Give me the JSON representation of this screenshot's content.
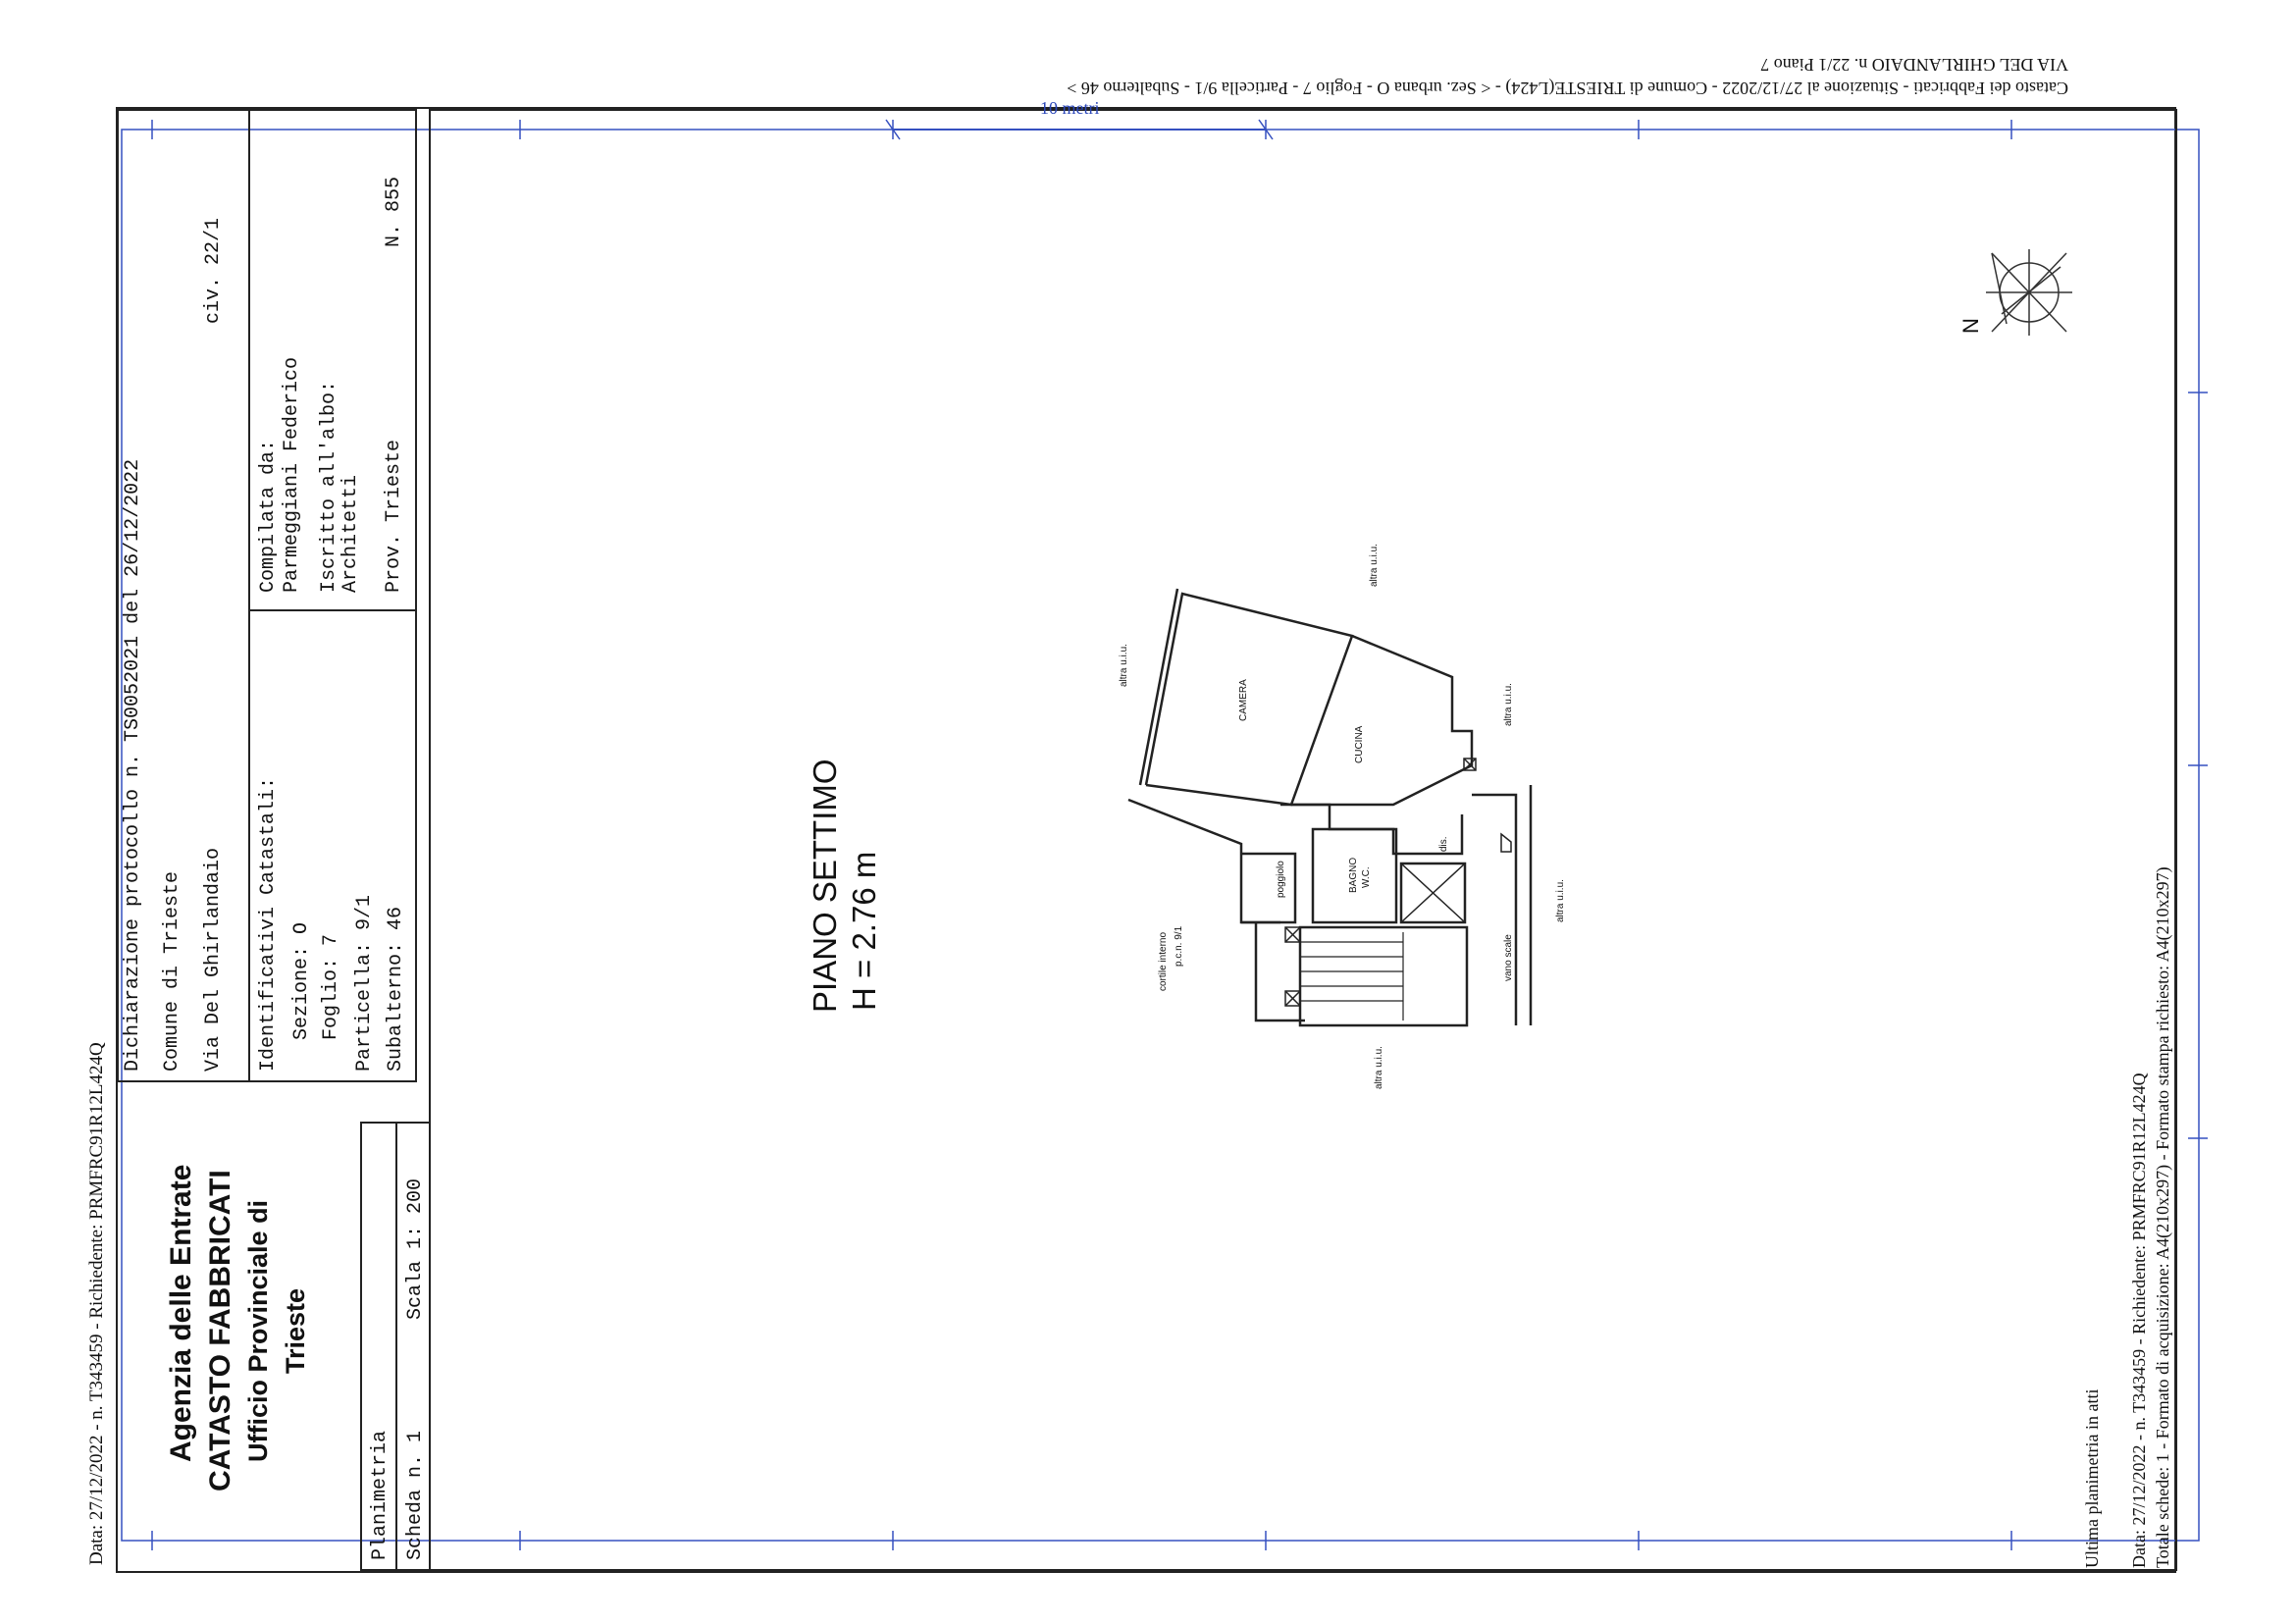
{
  "left_margin": {
    "text": "Data: 27/12/2022 - n. T343459 - Richiedente: PRMFRC91R12L424Q"
  },
  "top_header": {
    "line1": "VIA DEL GHIRLANDAIO n. 22/1 Piano 7",
    "line2": "Catasto dei Fabbricati - Situazione al 27/12/2022 - Comune di TRIESTE(L424) - < Sez. urbana O - Foglio 7 - Particella 9/1 - Subalterno 46 >"
  },
  "scale_bar": {
    "label": "10 metri"
  },
  "title_block": {
    "agency_line1": "Agenzia delle Entrate",
    "agency_line2": "CATASTO FABBRICATI",
    "office_line1": "Ufficio Provinciale di",
    "office_line2": "Trieste",
    "doc_type": "Planimetria",
    "sheet": "Scheda n. 1",
    "scale": "Scala 1: 200",
    "protocol": "Dichiarazione protocollo n. TS0052021 del 26/12/2022",
    "comune": "Comune di Trieste",
    "via": "Via Del Ghirlandaio",
    "civ": "civ. 22/1",
    "id_label": "Identificativi Catastali:",
    "sezione": "Sezione: O",
    "foglio": "Foglio: 7",
    "particella": "Particella: 9/1",
    "subalterno": "Subalterno: 46",
    "compilata_label": "Compilata da:",
    "compilata_name": "Parmeggiani Federico",
    "iscritto_label": "Iscritto all'albo:",
    "iscritto_value": "Architetti",
    "prov": "Prov. Trieste",
    "number": "N. 855"
  },
  "plan": {
    "floor_name": "PIANO SETTIMO",
    "height": "H = 2.76 m",
    "north": "N",
    "rooms": {
      "camera": "CAMERA",
      "cucina": "CUCINA",
      "bagno1": "BAGNO",
      "bagno2": "W.C.",
      "poggiolo": "poggiolo",
      "dis": "dis.",
      "vano_scale": "vano scale",
      "cortile1": "cortile interno",
      "cortile2": "p.c.n. 9/1"
    },
    "altra_uiu": "altra u.i.u."
  },
  "footer": {
    "line1": "Ultima planimetria in atti",
    "line2": "Data: 27/12/2022 - n. T343459 - Richiedente: PRMFRC91R12L424Q",
    "line3": "Totale schede: 1 - Formato di acquisizione: A4(210x297) - Formato stampa richiesto: A4(210x297)"
  }
}
